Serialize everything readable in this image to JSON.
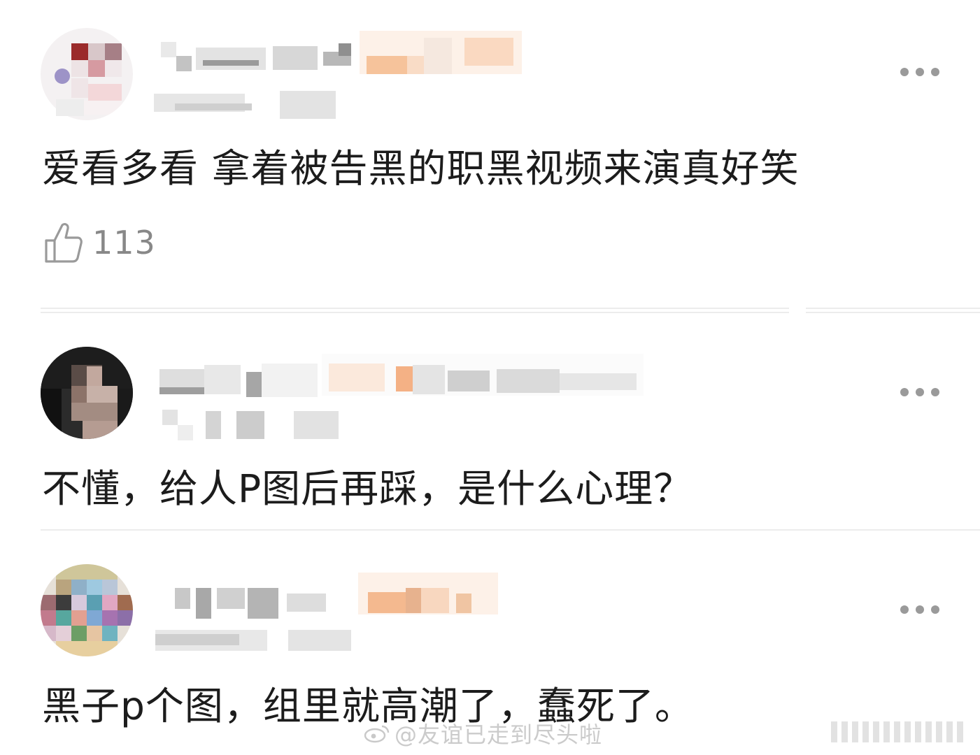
{
  "comments": [
    {
      "text": "爱看多看 拿着被告黑的职黑视频来演真好笑",
      "likes": "113",
      "more_icon": "more-dots-icon",
      "avatar": "pixelated",
      "username": "pixelated",
      "badge": "pixelated",
      "meta": "pixelated"
    },
    {
      "text": "不懂，给人P图后再踩，是什么心理？",
      "more_icon": "more-dots-icon",
      "avatar": "pixelated",
      "username": "pixelated",
      "badge": "pixelated",
      "meta": "pixelated"
    },
    {
      "text": "黑子p个图，组里就高潮了，蠢死了。",
      "more_icon": "more-dots-icon",
      "avatar": "pixelated",
      "username": "pixelated",
      "badge": "pixelated",
      "meta": "pixelated"
    }
  ],
  "like_icon": "thumbs-up-icon",
  "watermark": {
    "text": "@友谊已走到尽头啦",
    "logo": "weibo-logo-icon"
  },
  "colors": {
    "text": "#1c1c1c",
    "muted": "#888888",
    "badge_orange": "#f4a66a",
    "divider": "#ececec"
  }
}
